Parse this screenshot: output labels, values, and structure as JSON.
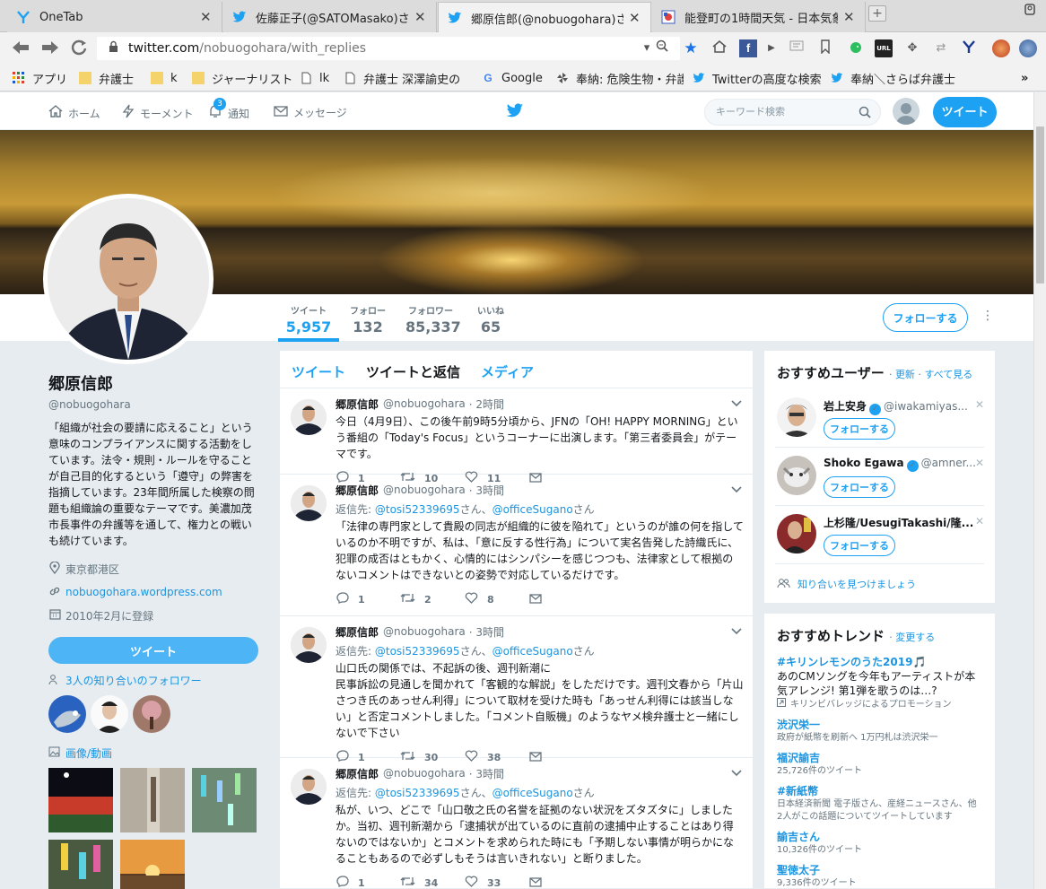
{
  "browser": {
    "tabs": [
      {
        "title": "OneTab",
        "icon": "onetab-icon"
      },
      {
        "title": "佐藤正子(@SATOMasako)さん",
        "icon": "twitter-bird-icon"
      },
      {
        "title": "郷原信郎(@nobuogohara)さん",
        "icon": "twitter-bird-icon"
      },
      {
        "title": "能登町の1時間天気 - 日本気象",
        "icon": "weather-icon"
      }
    ],
    "url_host": "twitter.com",
    "url_path": "/nobuogohara/with_replies",
    "bookmarks": [
      {
        "label": "アプリ",
        "icon": "apps-grid-icon"
      },
      {
        "label": "弁護士",
        "icon": "folder-icon"
      },
      {
        "label": "k",
        "icon": "folder-icon"
      },
      {
        "label": "ジャーナリスト",
        "icon": "folder-icon"
      },
      {
        "label": "lk",
        "icon": "page-icon"
      },
      {
        "label": "弁護士 深澤諭史の",
        "icon": "page-icon"
      },
      {
        "label": "Google",
        "icon": "google-icon"
      },
      {
        "label": "奉納: 危険生物・弁護",
        "icon": "pinwheel-icon"
      },
      {
        "label": "Twitterの高度な検索",
        "icon": "twitter-bird-icon"
      },
      {
        "label": "奉納＼さらば弁護士",
        "icon": "twitter-bird-icon"
      }
    ],
    "more_bookmarks": "»"
  },
  "twitter_nav": {
    "home": "ホーム",
    "moments": "モーメント",
    "notifications": "通知",
    "notification_count": "3",
    "messages": "メッセージ",
    "search_placeholder": "キーワード検索",
    "tweet_button": "ツイート"
  },
  "profile": {
    "name": "郷原信郎",
    "handle": "@nobuogohara",
    "bio": "「組織が社会の要請に応えること」という意味のコンプライアンスに関する活動をしています。法令・規則・ルールを守ることが自己目的化するという「遵守」の弊害を指摘しています。23年間所属した検察の問題も組織論の重要なテーマです。美濃加茂市長事件の弁護等を通して、権力との戦いも続けています。",
    "location": "東京都港区",
    "website": "nobuogohara.wordpress.com",
    "joined": "2010年2月に登録",
    "tweet_button": "ツイート",
    "known_followers": "3人の知り合いのフォロワー",
    "media_link": "画像/動画",
    "follow_button": "フォローする",
    "stats": [
      {
        "label": "ツイート",
        "value": "5,957"
      },
      {
        "label": "フォロー",
        "value": "132"
      },
      {
        "label": "フォロワー",
        "value": "85,337"
      },
      {
        "label": "いいね",
        "value": "65"
      }
    ]
  },
  "timeline": {
    "tabs": [
      "ツイート",
      "ツイートと返信",
      "メディア"
    ],
    "tweets": [
      {
        "name": "郷原信郎",
        "handle": "@nobuogohara",
        "time": "· 2時間",
        "reply_to": null,
        "text": "今日（4月9日）、この後午前9時5分頃から、JFNの「OH! HAPPY MORNING」という番組の「Today's Focus」というコーナーに出演します。「第三者委員会」がテーマです。",
        "replies": "1",
        "retweets": "10",
        "likes": "11"
      },
      {
        "name": "郷原信郎",
        "handle": "@nobuogohara",
        "time": "· 3時間",
        "reply_to": {
          "prefix": "返信先: ",
          "u1": "@tosi52339695",
          "mid": "さん、",
          "u2": "@officeSugano",
          "suffix": "さん"
        },
        "text": "「法律の専門家として貴殿の同志が組織的に彼を陥れて」というのが誰の何を指しているのか不明ですが、私は、「意に反する性行為」について実名告発した詩織氏に、犯罪の成否はともかく、心情的にはシンパシーを感じつつも、法律家として根拠のないコメントはできないとの姿勢で対応しているだけです。",
        "replies": "1",
        "retweets": "2",
        "likes": "8"
      },
      {
        "name": "郷原信郎",
        "handle": "@nobuogohara",
        "time": "· 3時間",
        "reply_to": {
          "prefix": "返信先: ",
          "u1": "@tosi52339695",
          "mid": "さん、",
          "u2": "@officeSugano",
          "suffix": "さん"
        },
        "text": "山口氏の関係では、不起訴の後、週刊新潮に\n民事訴訟の見通しを聞かれて「客観的な解説」をしただけです。週刊文春から「片山さつき氏のあっせん利得」について取材を受けた時も「あっせん利得には該当しない」と否定コメントしました。「コメント自販機」のようなヤメ検弁護士と一緒にしないで下さい",
        "replies": "1",
        "retweets": "30",
        "likes": "38"
      },
      {
        "name": "郷原信郎",
        "handle": "@nobuogohara",
        "time": "· 3時間",
        "reply_to": {
          "prefix": "返信先: ",
          "u1": "@tosi52339695",
          "mid": "さん、",
          "u2": "@officeSugano",
          "suffix": "さん"
        },
        "text": "私が、いつ、どこで「山口敬之氏の名誉を証拠のない状況をズタズタに」しましたか。当初、週刊新潮から「逮捕状が出ているのに直前の逮捕中止することはあり得ないのではないか」とコメントを求められた時にも「予期しない事情が明らかになることもあるので必ずしもそうは言いきれない」と断りました。",
        "replies": "1",
        "retweets": "34",
        "likes": "33"
      }
    ]
  },
  "who_to_follow": {
    "title": "おすすめユーザー",
    "refresh": "更新",
    "view_all": "すべて見る",
    "follow_label": "フォローする",
    "users": [
      {
        "name": "岩上安身",
        "verified": true,
        "handle": "@iwakamiyas..."
      },
      {
        "name": "Shoko Egawa",
        "verified": true,
        "handle": "@amner..."
      },
      {
        "name": "上杉隆/UesugiTakashi/隆...",
        "verified": false,
        "handle": ""
      }
    ],
    "find_friends": "知り合いを見つけましょう"
  },
  "trends": {
    "title": "おすすめトレンド",
    "change": "変更する",
    "items": [
      {
        "name": "#キリンレモンのうた2019🎵",
        "desc": "あのCMソングを今年もアーティストが本気アレンジ! 第1弾を歌うのは…?",
        "meta": "キリンビバレッジによるプロモーション"
      },
      {
        "name": "渋沢栄一",
        "desc": "",
        "meta": "政府が紙幣を刷新へ 1万円札は渋沢栄一"
      },
      {
        "name": "福沢諭吉",
        "desc": "",
        "meta": "25,726件のツイート"
      },
      {
        "name": "#新紙幣",
        "desc": "",
        "meta": "日本経済新聞 電子版さん、産経ニュースさん、他2人がこの話題についてツイートしています"
      },
      {
        "name": "諭吉さん",
        "desc": "",
        "meta": "10,326件のツイート"
      },
      {
        "name": "聖徳太子",
        "desc": "",
        "meta": "9,336件のツイート"
      }
    ]
  },
  "colors": {
    "twitter_blue": "#1da1f2",
    "link_blue": "#1b95e0",
    "gray_text": "#66757f"
  }
}
